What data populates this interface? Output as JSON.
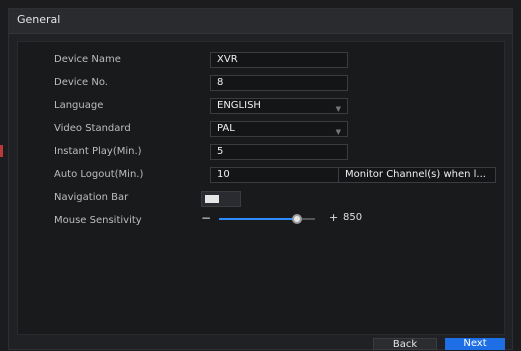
{
  "window": {
    "title": "General"
  },
  "rows": [
    {
      "label": "Device Name",
      "value": "XVR"
    },
    {
      "label": "Device No.",
      "value": "8"
    },
    {
      "label": "Language",
      "value": "ENGLISH"
    },
    {
      "label": "Video Standard",
      "value": "PAL"
    },
    {
      "label": "Instant Play(Min.)",
      "value": "5"
    },
    {
      "label": "Auto Logout(Min.)",
      "value": "10"
    },
    {
      "label": "Navigation Bar",
      "value": ""
    },
    {
      "label": "Mouse Sensitivity",
      "value": ""
    }
  ],
  "monitor_button": {
    "label": "Monitor Channel(s) when l..."
  },
  "navigation_toggle": {
    "state": "off"
  },
  "mouse_slider": {
    "minus": "−",
    "plus": "+",
    "value": "850",
    "fraction": 0.85
  },
  "footer": {
    "back": "Back",
    "next": "Next"
  },
  "colors": {
    "accent": "#1e6fe6",
    "slider": "#2f8cff"
  }
}
